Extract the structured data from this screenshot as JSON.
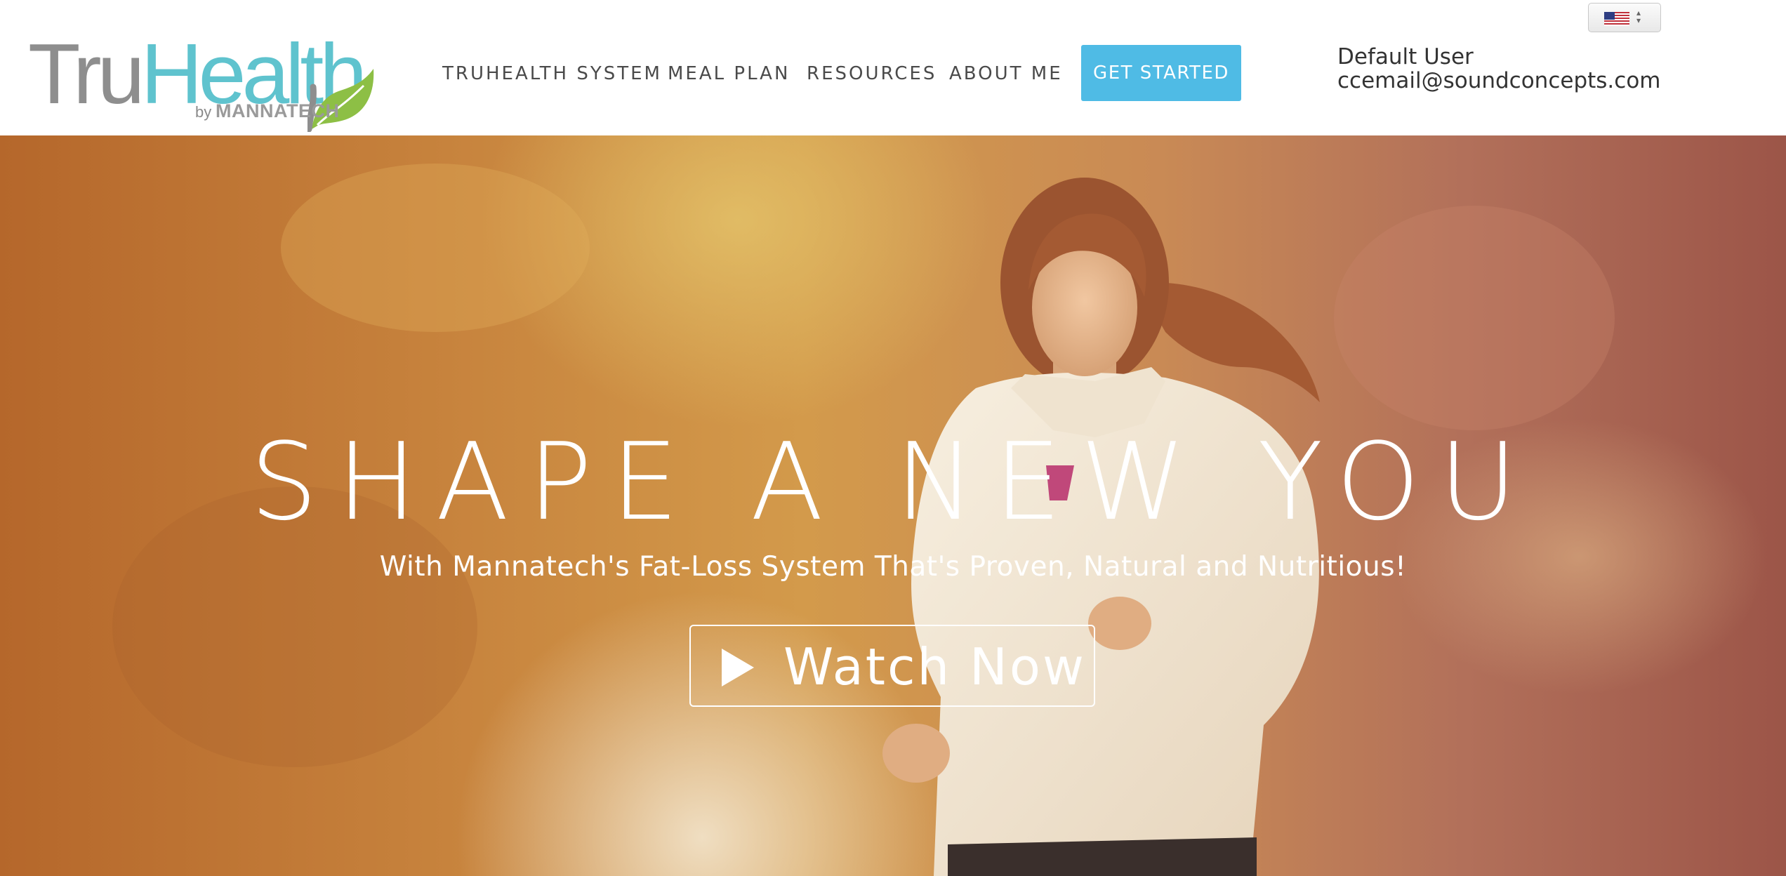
{
  "logo": {
    "tru": "Tru",
    "health": "Health",
    "by": "by",
    "company": "MANNATECH"
  },
  "nav": {
    "items": [
      {
        "label": "TRUHEALTH SYSTEM"
      },
      {
        "label": "MEAL PLAN"
      },
      {
        "label": "RESOURCES"
      },
      {
        "label": "ABOUT ME"
      }
    ],
    "cta_label": "GET STARTED"
  },
  "user": {
    "name": "Default User",
    "email": "ccemail@soundconcepts.com"
  },
  "language": {
    "selected_flag_icon": "us-flag-icon"
  },
  "hero": {
    "title": "SHAPE A NEW YOU",
    "subtitle": "With Mannatech's Fat-Loss System That's Proven, Natural and Nutritious!",
    "watch_label": "Watch Now"
  },
  "colors": {
    "cta": "#4fbbe5",
    "logo_gray": "#8e8e8e",
    "logo_teal": "#5fc3ce",
    "leaf_green": "#8dbf45",
    "hero_warm": "#c98a45"
  }
}
